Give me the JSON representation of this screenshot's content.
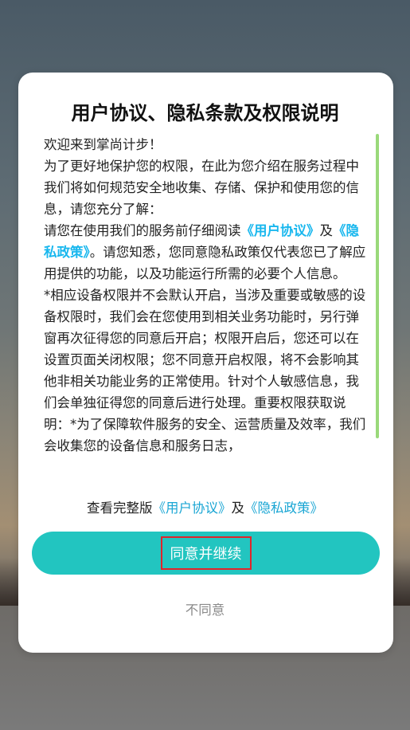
{
  "dialog": {
    "title": "用户协议、隐私条款及权限说明",
    "paragraphs": {
      "p1": "欢迎来到掌尚计步！",
      "p2": "为了更好地保护您的权限，在此为您介绍在服务过程中我们将如何规范安全地收集、存储、保护和使用您的信息，请您充分了解：",
      "p3_pre": "请您在使用我们的服务前仔细阅读",
      "p3_link1": "《用户协议》",
      "p3_mid": "及",
      "p3_link2": "《隐私政策》",
      "p3_post": "。请您知悉，您同意隐私政策仅代表您已了解应用提供的功能，以及功能运行所需的必要个人信息。",
      "p4": "*相应设备权限并不会默认开启，当涉及重要或敏感的设备权限时，我们会在您使用到相关业务功能时，另行弹窗再次征得您的同意后开启；权限开启后，您还可以在设置页面关闭权限；您不同意开启权限，将不会影响其他非相关功能业务的正常使用。针对个人敏感信息，我们会单独征得您的同意后进行处理。重要权限获取说明：*为了保障软件服务的安全、运营质量及效率，我们会收集您的设备信息和服务日志，"
    },
    "view_full": {
      "prefix": "查看完整版",
      "link1": "《用户协议》",
      "mid": "及",
      "link2": "《隐私政策》"
    },
    "agree_label": "同意并继续",
    "disagree_label": "不同意"
  },
  "colors": {
    "accent": "#22c5c0",
    "link": "#18b7ee",
    "highlight_box": "#e0252b",
    "scrollbar": "#9ad97a"
  }
}
